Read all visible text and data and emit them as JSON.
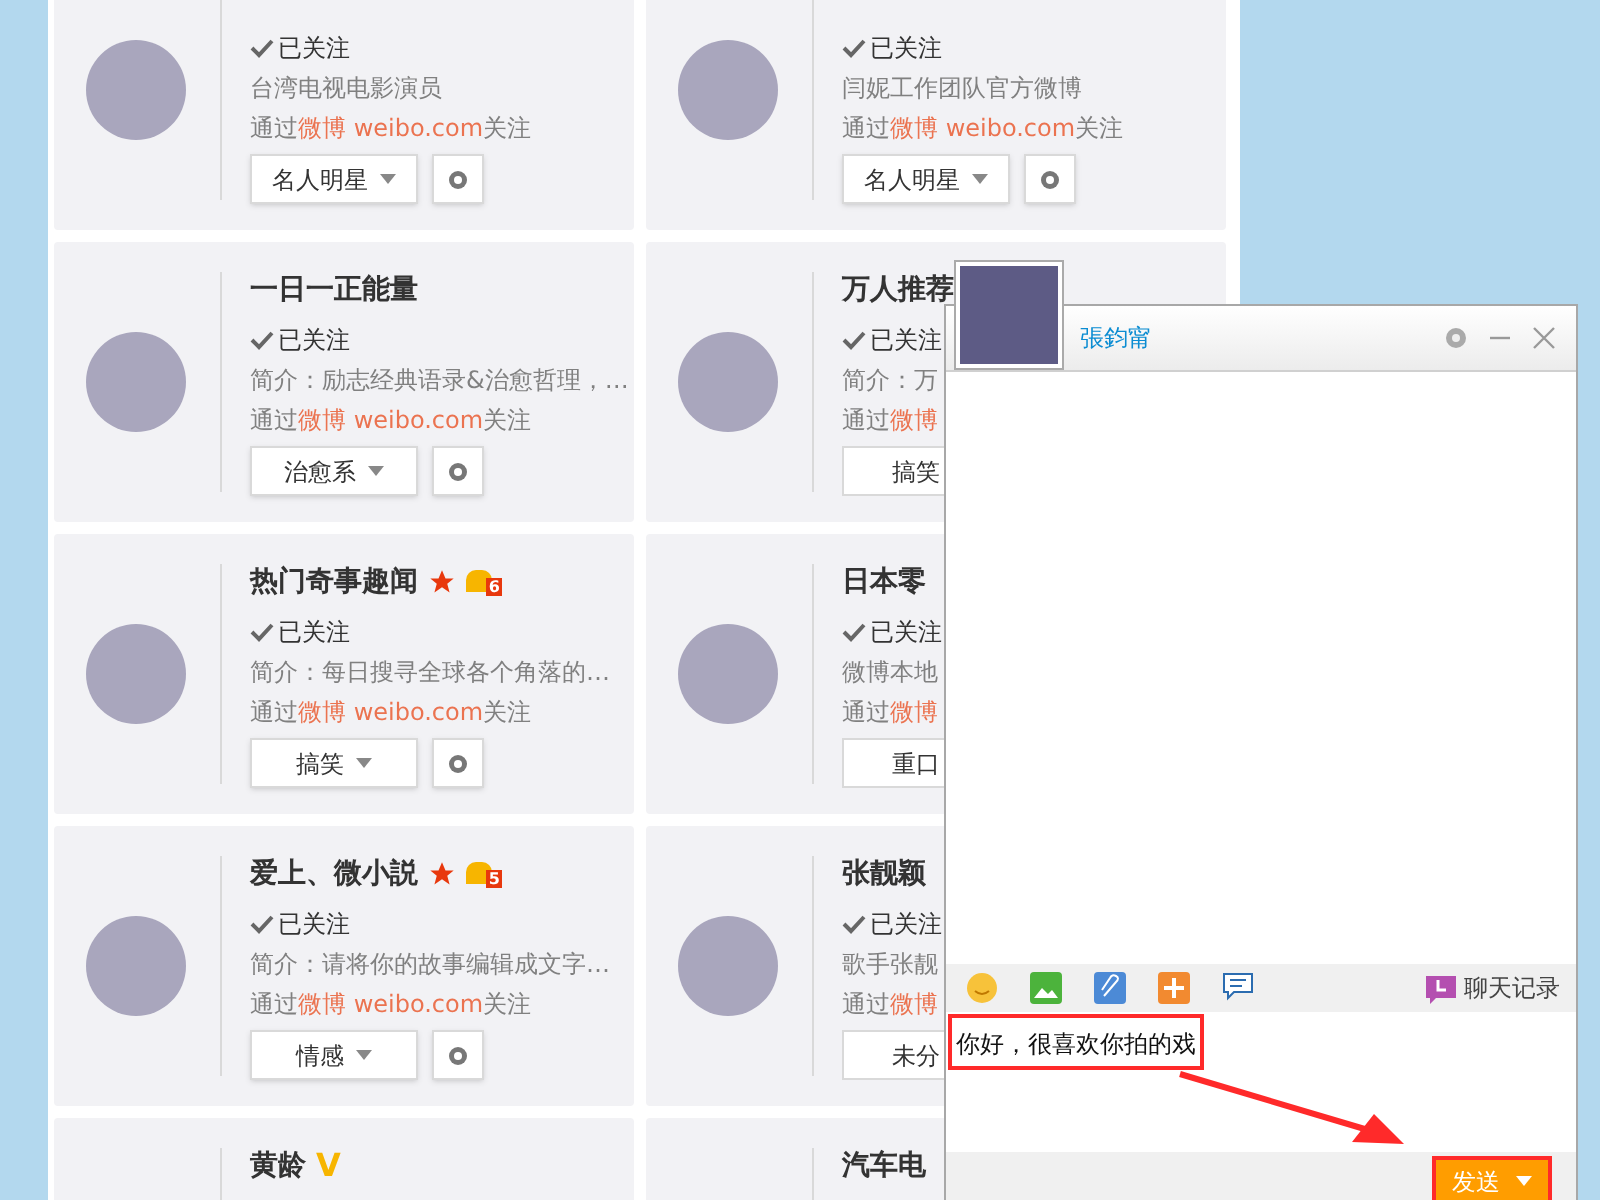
{
  "cards": [
    {
      "status": "已关注",
      "desc": "台湾电视电影演员",
      "via": {
        "prefix": "通过",
        "link": "微博 weibo.com",
        "suffix": "关注"
      },
      "group": "名人明星"
    },
    {
      "status": "已关注",
      "desc": "闫妮工作团队官方微博",
      "via": {
        "prefix": "通过",
        "link": "微博 weibo.com",
        "suffix": "关注"
      },
      "group": "名人明星"
    },
    {
      "name": "一日一正能量",
      "status": "已关注",
      "desc": "简介：励志经典语录&治愈哲理，…",
      "via": {
        "prefix": "通过",
        "link": "微博 weibo.com",
        "suffix": "关注"
      },
      "group": "治愈系"
    },
    {
      "name": "万人推荐",
      "status": "已关注",
      "desc": "简介：万",
      "via": {
        "prefix": "通过",
        "link": "微博"
      },
      "group": "搞笑"
    },
    {
      "name": "热门奇事趣闻",
      "badges": [
        {
          "kind": "star"
        },
        {
          "kind": "crown",
          "text": "6"
        }
      ],
      "status": "已关注",
      "desc": "简介：每日搜寻全球各个角落的…",
      "via": {
        "prefix": "通过",
        "link": "微博 weibo.com",
        "suffix": "关注"
      },
      "group": "搞笑"
    },
    {
      "name": "日本零",
      "status": "已关注",
      "desc": "微博本地",
      "via": {
        "prefix": "通过",
        "link": "微博"
      },
      "group": "重口"
    },
    {
      "name": "爱上、微小説",
      "badges": [
        {
          "kind": "star"
        },
        {
          "kind": "crown",
          "text": "5"
        }
      ],
      "status": "已关注",
      "desc": "简介：请将你的故事编辑成文字…",
      "via": {
        "prefix": "通过",
        "link": "微博 weibo.com",
        "suffix": "关注"
      },
      "group": "情感"
    },
    {
      "name": "张靓颖",
      "status": "已关注",
      "desc": "歌手张靓",
      "via": {
        "prefix": "通过",
        "link": "微博"
      },
      "group": "未分"
    },
    {
      "name": "黄龄",
      "badges": [
        {
          "kind": "verified",
          "text": "V"
        }
      ]
    },
    {
      "name": "汽车电"
    }
  ],
  "chat": {
    "title": "張鈞甯",
    "input": "你好，很喜欢你拍的戏",
    "history": "聊天记录",
    "send": "发送"
  }
}
